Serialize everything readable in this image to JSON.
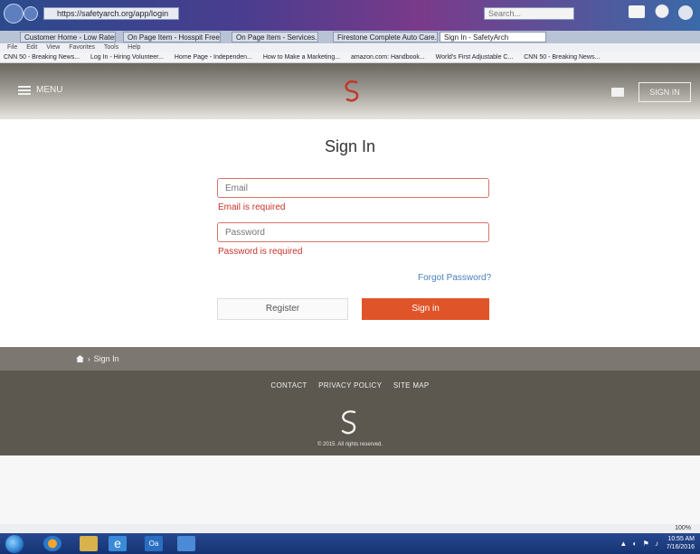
{
  "browser": {
    "url": "https://safetyarch.org/app/login",
    "url_domain": "safetyarch.org",
    "search_placeholder": "Search...",
    "tabs": [
      "Customer Home - Low Rates",
      "On Page Item - Hosspit Free...",
      "On Page Item - Services...",
      "Firestone Complete Auto Care...",
      "Sign In - SafetyArch"
    ],
    "menu": [
      "File",
      "Edit",
      "View",
      "Favorites",
      "Tools",
      "Help"
    ],
    "favorites": [
      "CNN 50 - Breaking News...",
      "Log In - Hiring Volunteer...",
      "Home Page - Independen...",
      "How to Make a Marketing...",
      "amazon.com: Handbook...",
      "World's First Adjustable C...",
      "CNN 50 - Breaking News..."
    ],
    "zoom": "100%"
  },
  "header": {
    "menu_label": "MENU",
    "signin_label": "SIGN IN"
  },
  "main": {
    "title": "Sign In",
    "email_placeholder": "Email",
    "email_error": "Email is required",
    "password_placeholder": "Password",
    "password_error": "Password is required",
    "forgot_label": "Forgot Password?",
    "register_label": "Register",
    "signin_label": "Sign in"
  },
  "breadcrumb": {
    "current": "Sign In"
  },
  "footer": {
    "links": [
      "CONTACT",
      "PRIVACY POLICY",
      "SITE MAP"
    ],
    "copyright": "© 2015. All rights reserved."
  },
  "taskbar": {
    "time": "10:55 AM",
    "date": "7/16/2016"
  },
  "colors": {
    "accent": "#e0542a",
    "error": "#c8332a",
    "link": "#4a7fc0",
    "footer": "#5c584f"
  }
}
